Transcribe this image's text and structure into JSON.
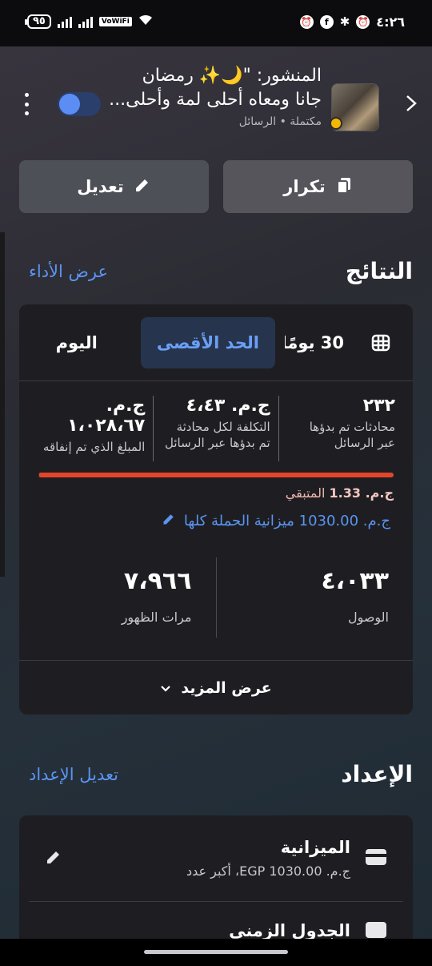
{
  "status_bar": {
    "battery": "٩٥",
    "network_label": "VoWiFi",
    "time": "٤:٢٦"
  },
  "header": {
    "post_title": "المنشور: \"🌙✨ رمضان",
    "post_subtitle": "جانا ومعاه أحلى لمة وأحلى...",
    "post_meta": "مكتملة • الرسائل",
    "toggle_on": true,
    "icons": {
      "back": "chevron-right-icon",
      "menu": "more-vertical-icon"
    }
  },
  "actions": {
    "edit_label": "تعديل",
    "duplicate_label": "تكرار"
  },
  "results": {
    "title": "النتائج",
    "view_performance": "عرض الأداء",
    "tabs": [
      {
        "label": "30 يومًا",
        "active": false
      },
      {
        "label": "الحد الأقصى",
        "active": true
      },
      {
        "label": "اليوم",
        "active": false
      }
    ],
    "metrics": [
      {
        "value": "٢٣٢",
        "label_1": "محادثات تم بدؤها",
        "label_2": "عبر الرسائل"
      },
      {
        "value": "ج.م. ٤،٤٣",
        "label_1": "التكلفة لكل محادثة",
        "label_2": "تم بدؤها عبر الرسائل"
      },
      {
        "value": "ج.م. ١،٠٢٨،٦٧",
        "label_1": "المبلغ الذي تم إنفاقه",
        "label_2": ""
      }
    ],
    "spend_fraction": 0.9987,
    "remaining_amount": "ج.م. 1.33",
    "remaining_label": "المتبقي",
    "campaign_budget": "ج.م. 1030.00 ميزانية الحملة كلها",
    "reach_value": "٤،٠٣٣",
    "reach_label": "الوصول",
    "impressions_value": "٧،٩٦٦",
    "impressions_label": "مرات الظهور",
    "see_more": "عرض المزيد"
  },
  "setup": {
    "title": "الإعداد",
    "edit_link": "تعديل الإعداد",
    "budget_title": "الميزانية",
    "budget_sub": "ج.م. EGP 1030.00، أكبر عدد",
    "schedule_title": "الجدول الزمني"
  },
  "colors": {
    "accent": "#5b94f0",
    "progress": "#e2452a",
    "active_tab_bg": "#26344e"
  }
}
